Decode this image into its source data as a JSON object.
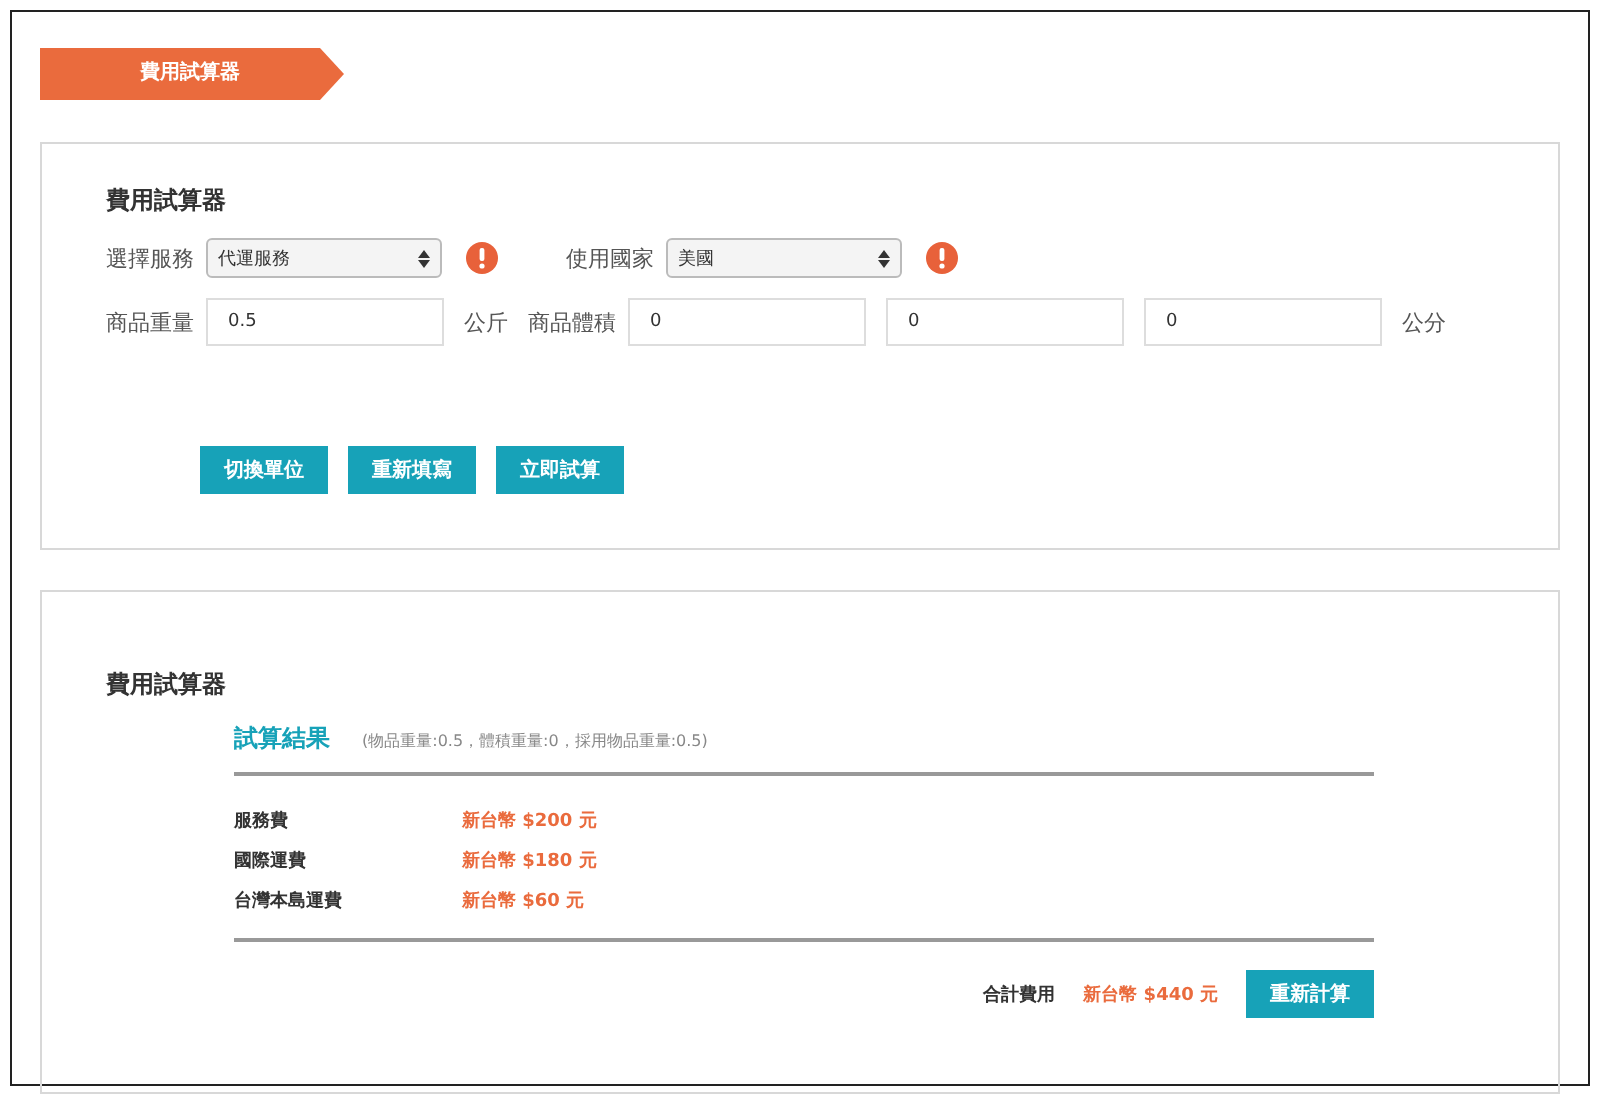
{
  "banner": {
    "title": "費用試算器"
  },
  "form": {
    "title": "費用試算器",
    "service": {
      "label": "選擇服務",
      "value": "代運服務"
    },
    "country": {
      "label": "使用國家",
      "value": "美國"
    },
    "weight": {
      "label": "商品重量",
      "value": "0.5",
      "unit": "公斤"
    },
    "volume": {
      "label": "商品體積",
      "values": [
        "0",
        "0",
        "0"
      ],
      "unit": "公分"
    },
    "buttons": [
      "切換單位",
      "重新填寫",
      "立即試算"
    ]
  },
  "result": {
    "title": "費用試算器",
    "heading": "試算結果",
    "note": "(物品重量:0.5，體積重量:0，採用物品重量:0.5)",
    "fees": [
      {
        "label": "服務費",
        "amount": "新台幣 $200 元"
      },
      {
        "label": "國際運費",
        "amount": "新台幣 $180 元"
      },
      {
        "label": "台灣本島運費",
        "amount": "新台幣 $60 元"
      }
    ],
    "total_label": "合計費用",
    "total": "新台幣 $440 元",
    "button": "重新計算"
  }
}
